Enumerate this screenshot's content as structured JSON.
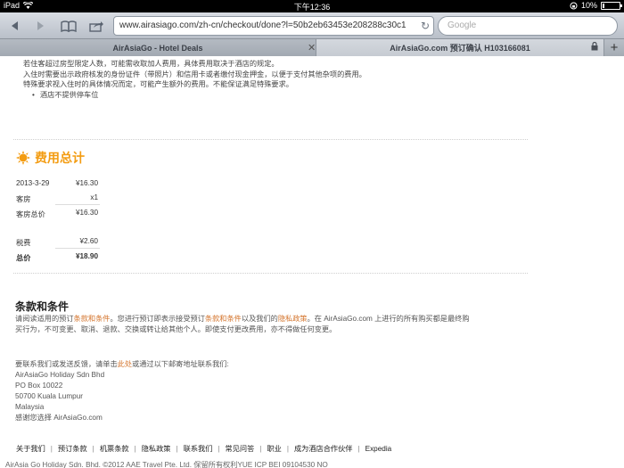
{
  "statusbar": {
    "device": "iPad",
    "time": "下午12:36",
    "battery": "10%"
  },
  "toolbar": {
    "url": "www.airasiago.com/zh-cn/checkout/done?l=50b2eb63453e208288c30c1",
    "search_placeholder": "Google"
  },
  "tabs": [
    {
      "label": "AirAsiaGo - Hotel Deals",
      "active": false
    },
    {
      "label": "AirAsiaGo.com 预订确认 H103166081",
      "active": true
    }
  ],
  "hotel_notes": {
    "lines": [
      "若住客超过房型限定人数，可能需收取加人费用，具体费用取决于酒店的规定。",
      "入住时需要出示政府核发的身份证件（带照片）和信用卡或者缴付现金押金，以便于支付其他杂项的费用。",
      "特殊要求视入住时的具体情况而定，可能产生额外的费用。不能保证满足特殊要求。"
    ],
    "bullet": "酒店不提供停车位"
  },
  "fees": {
    "heading": "费用总计",
    "rows": [
      {
        "label": "2013-3-29",
        "amount": "¥16.30"
      },
      {
        "label": "客房",
        "amount": "x1"
      },
      {
        "label": "客房总价",
        "amount": "¥16.30"
      },
      {
        "label": "税费",
        "amount": "¥2.60"
      },
      {
        "label": "总价",
        "amount": "¥18.90"
      }
    ]
  },
  "terms": {
    "title": "条款和条件",
    "p1": "请阅读适用的预订",
    "l1": "条款和条件",
    "p2": "。您进行预订即表示接受预订",
    "l2": "条款和条件",
    "p3": "以及我们的",
    "l3": "隐私政策",
    "p4": "。在 AirAsiaGo.com 上进行的所有购买都是最终购",
    "line2": "买行为，不可变更、取消、退款、交换或转让给其他个人。即使支付更改费用，亦不得做任何变更。"
  },
  "contact": {
    "intro_a": "要联系我们或发送反馈，请单击",
    "intro_link": "此处",
    "intro_b": "或通过以下邮寄地址联系我们:",
    "lines": [
      "AirAsiaGo Holiday Sdn Bhd",
      "PO Box 10022",
      "50700 Kuala Lumpur",
      "Malaysia",
      "感谢您选择 AirAsiaGo.com"
    ]
  },
  "footer": {
    "links": [
      "关于我们",
      "预订条款",
      "机票条款",
      "隐私政策",
      "联系我们",
      "常见问答",
      "职业",
      "成为酒店合作伙伴",
      "Expedia"
    ],
    "copyright": "AirAsia Go Holiday Sdn. Bhd. ©2012 AAE Travel Pte. Ltd. 保留所有权利YUE ICP BEI 09104530 NO"
  },
  "colors": {
    "accent": "#f39c12",
    "link": "#d4752e"
  }
}
